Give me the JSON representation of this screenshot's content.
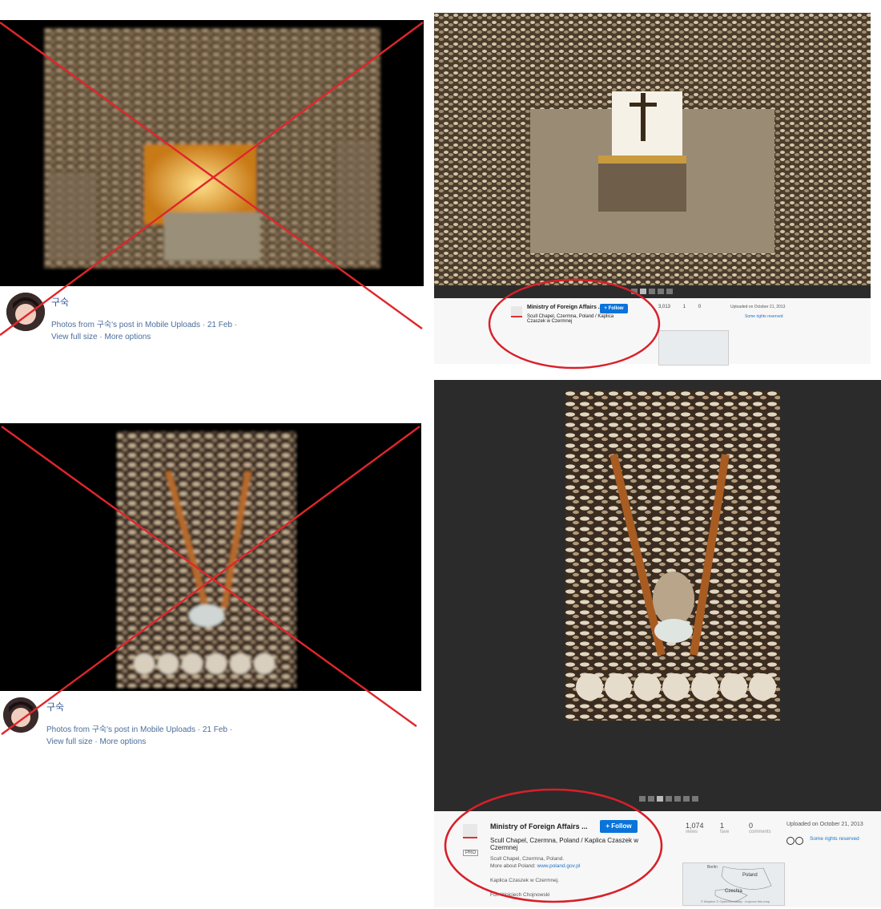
{
  "fb_top": {
    "name": "구숙",
    "meta_text": "Photos from 구숙's post in Mobile Uploads · 21 Feb ·",
    "links": "View full size · More options"
  },
  "fb_bottom": {
    "name": "구숙",
    "meta_text": "Photos from 구숙's post in Mobile Uploads · 21 Feb ·",
    "links": "View full size · More options"
  },
  "flickr_top": {
    "title": "Ministry of Foreign Affairs ...",
    "follow": "+ Follow",
    "photo_title": "Scull Chapel, Czermna, Poland / Kaplica Czaszek w Czermnej",
    "stats": [
      {
        "num": "3,013",
        "label": "views"
      },
      {
        "num": "1",
        "label": "fave"
      },
      {
        "num": "0",
        "label": "comments"
      }
    ],
    "uploaded": "Uploaded on October 21, 2013",
    "rights": "Some rights reserved"
  },
  "flickr_bottom": {
    "title": "Ministry of Foreign Affairs ...",
    "follow": "+ Follow",
    "photo_title": "Scull Chapel, Czermna, Poland / Kaplica Czaszek w Czermnej",
    "pro_badge": "PRO",
    "desc_line1": "Scull Chapel, Czermna, Poland.",
    "desc_line2_prefix": "More about Poland: ",
    "desc_link": "www.poland.gov.pl",
    "desc_line3": "Kaplica Czaszek w Czermnej.",
    "desc_line4": "Fot. Wojciech Chojnowski",
    "stats": [
      {
        "num": "1,074",
        "label": "views"
      },
      {
        "num": "1",
        "label": "fave"
      },
      {
        "num": "0",
        "label": "comments"
      }
    ],
    "uploaded": "Uploaded on October 21, 2013",
    "rights": "Some rights reserved",
    "map_labels": {
      "poland": "Poland",
      "czechia": "Czechia",
      "berlin": "Berlin"
    },
    "map_footer": "© Mapbox © OpenStreetMap · Improve this map"
  },
  "colors": {
    "cross_red": "#e0262b",
    "circle_red": "#d8202a",
    "fb_link": "#4b6d9b",
    "flickr_blue": "#0a74da"
  }
}
